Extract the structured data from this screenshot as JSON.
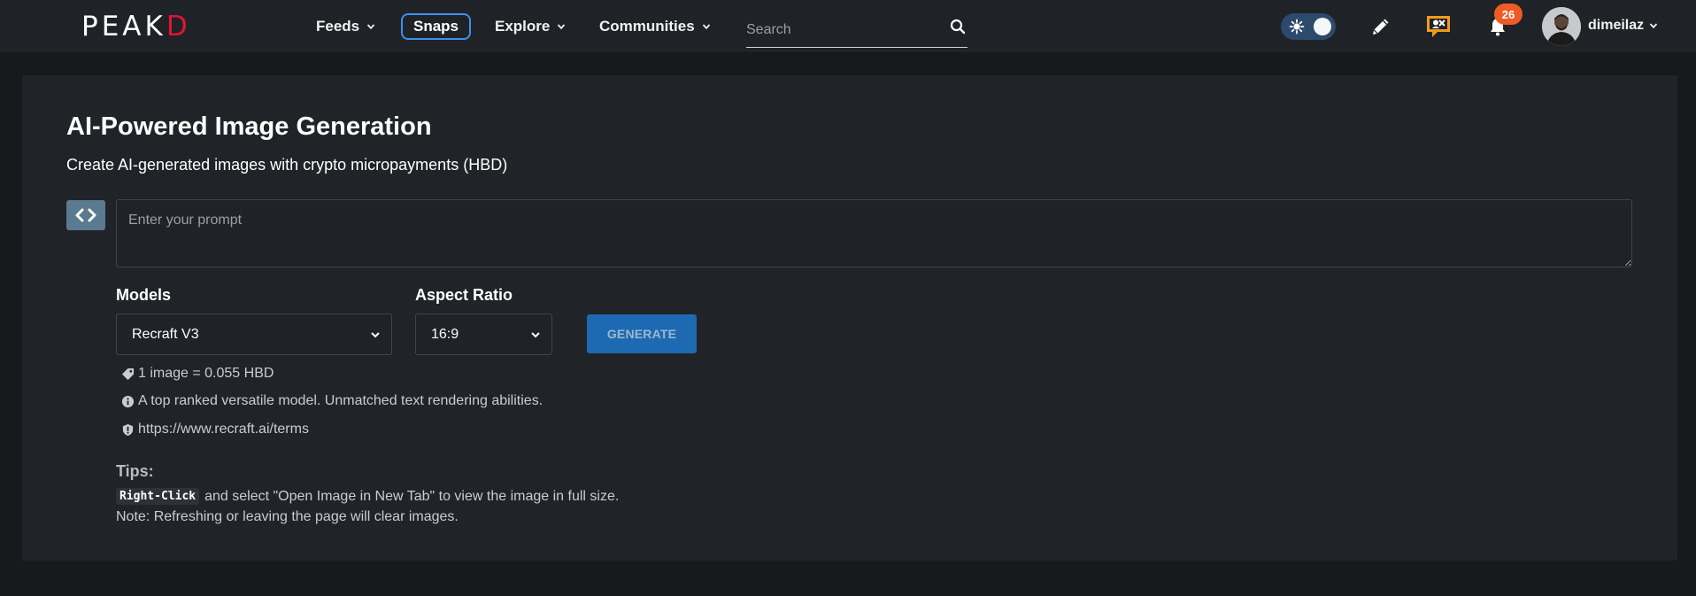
{
  "brand": {
    "logo_left": "PE",
    "logo_mid": "A",
    "logo_k": "K",
    "logo_right": "D",
    "accent": "#e31337"
  },
  "nav": {
    "feeds": "Feeds",
    "snaps": "Snaps",
    "explore": "Explore",
    "communities": "Communities",
    "search_placeholder": "Search"
  },
  "header": {
    "notification_count": "26",
    "username": "dimeilaz"
  },
  "main": {
    "title": "AI-Powered Image Generation",
    "subtitle": "Create AI-generated images with crypto micropayments (HBD)",
    "prompt_placeholder": "Enter your prompt",
    "models_label": "Models",
    "model_selected": "Recraft V3",
    "aspect_label": "Aspect Ratio",
    "aspect_selected": "16:9",
    "generate_label": "GENERATE",
    "price": "1 image = 0.055 HBD",
    "description": "A top ranked versatile model. Unmatched text rendering abilities.",
    "terms_url": "https://www.recraft.ai/terms",
    "tips_heading": "Tips:",
    "tip_key": "Right-Click",
    "tip_text": "and select \"Open Image in New Tab\" to view the image in full size.",
    "note": "Note: Refreshing or leaving the page will clear images."
  },
  "colors": {
    "background": "#17191c",
    "card": "#202328",
    "primary_button": "#1e6ab2",
    "snaps_border": "#3f8ef0",
    "badge": "#ef5b25",
    "chat_icon": "#f39a1c"
  }
}
